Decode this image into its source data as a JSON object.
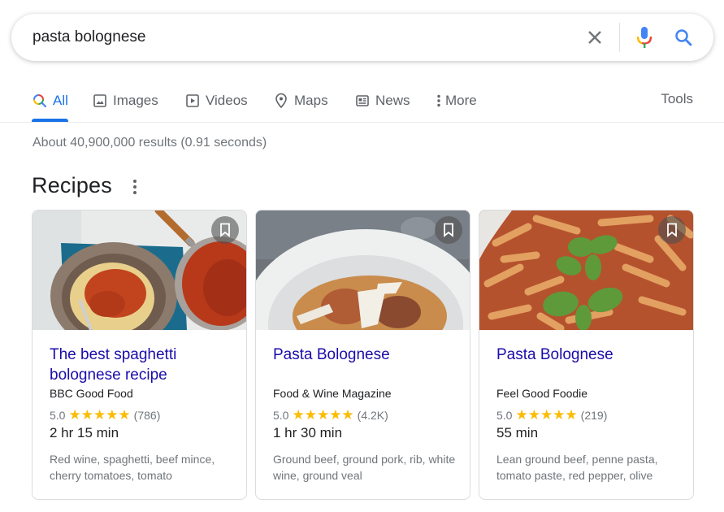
{
  "search": {
    "query": "pasta bolognese",
    "clear_icon": "close-icon",
    "mic_icon": "microphone-icon",
    "search_icon": "search-icon"
  },
  "tabs": {
    "items": [
      {
        "label": "All",
        "icon": "search-icon",
        "active": true
      },
      {
        "label": "Images",
        "icon": "image-icon"
      },
      {
        "label": "Videos",
        "icon": "play-icon"
      },
      {
        "label": "Maps",
        "icon": "map-pin-icon"
      },
      {
        "label": "News",
        "icon": "news-icon"
      },
      {
        "label": "More",
        "icon": "more-vert-icon"
      }
    ],
    "tools_label": "Tools"
  },
  "result_stats": "About 40,900,000 results (0.91 seconds)",
  "recipes": {
    "title": "Recipes",
    "cards": [
      {
        "title": "The best spaghetti bolognese recipe",
        "source": "BBC Good Food",
        "rating": "5.0",
        "stars": "★★★★★",
        "reviews": "(786)",
        "time": "2 hr 15 min",
        "ingredients": "Red wine, spaghetti, beef mince, cherry tomatoes, tomato",
        "image": "spaghetti bolognese in bowl with saucepan"
      },
      {
        "title": "Pasta Bolognese",
        "source": "Food & Wine Magazine",
        "rating": "5.0",
        "stars": "★★★★★",
        "reviews": "(4.2K)",
        "time": "1 hr 30 min",
        "ingredients": "Ground beef, ground pork, rib, white wine, ground veal",
        "image": "penne bolognese with parmesan shavings"
      },
      {
        "title": "Pasta Bolognese",
        "source": "Feel Good Foodie",
        "rating": "5.0",
        "stars": "★★★★★",
        "reviews": "(219)",
        "time": "55 min",
        "ingredients": "Lean ground beef, penne pasta, tomato paste, red pepper, olive",
        "image": "penne bolognese with basil"
      }
    ]
  },
  "colors": {
    "accent": "#1a73e8",
    "link": "#1a0dab",
    "star": "#fbbc04",
    "muted": "#70757a"
  }
}
